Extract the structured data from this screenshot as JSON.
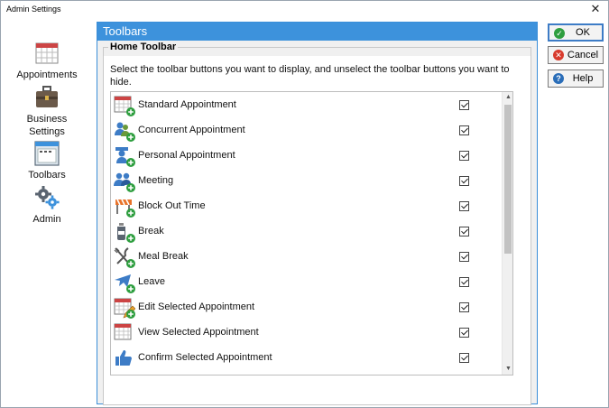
{
  "window": {
    "title": "Admin Settings",
    "close_glyph": "✕"
  },
  "nav": {
    "items": [
      {
        "label": "Appointments",
        "icon": "calendar-icon"
      },
      {
        "label": "Business\nSettings",
        "label_line1": "Business",
        "label_line2": "Settings",
        "icon": "briefcase-icon"
      },
      {
        "label": "Toolbars",
        "icon": "toolbar-window-icon"
      },
      {
        "label": "Admin",
        "icon": "gears-icon"
      }
    ]
  },
  "panel": {
    "header": "Toolbars",
    "group_title": "Home Toolbar",
    "description": "Select the toolbar buttons you want to display, and unselect the toolbar buttons you want to hide."
  },
  "toolbar_items": [
    {
      "label": "Standard Appointment",
      "icon": "calendar-add-icon",
      "checked": true
    },
    {
      "label": "Concurrent Appointment",
      "icon": "people-add-icon",
      "checked": true
    },
    {
      "label": "Personal Appointment",
      "icon": "person-add-icon",
      "checked": true
    },
    {
      "label": "Meeting",
      "icon": "group-add-icon",
      "checked": true
    },
    {
      "label": "Block Out Time",
      "icon": "barrier-add-icon",
      "checked": true
    },
    {
      "label": "Break",
      "icon": "coffee-add-icon",
      "checked": true
    },
    {
      "label": "Meal Break",
      "icon": "cutlery-add-icon",
      "checked": true
    },
    {
      "label": "Leave",
      "icon": "plane-add-icon",
      "checked": true
    },
    {
      "label": "Edit Selected Appointment",
      "icon": "calendar-edit-icon",
      "checked": true
    },
    {
      "label": "View Selected Appointment",
      "icon": "calendar-view-icon",
      "checked": true
    },
    {
      "label": "Confirm Selected Appointment",
      "icon": "thumbs-up-icon",
      "checked": true
    }
  ],
  "buttons": {
    "ok": "OK",
    "cancel": "Cancel",
    "help": "Help"
  },
  "colors": {
    "accent": "#3d92dc",
    "ok": "#2e9e3f",
    "cancel": "#d83b2d",
    "help": "#2a6db8"
  }
}
